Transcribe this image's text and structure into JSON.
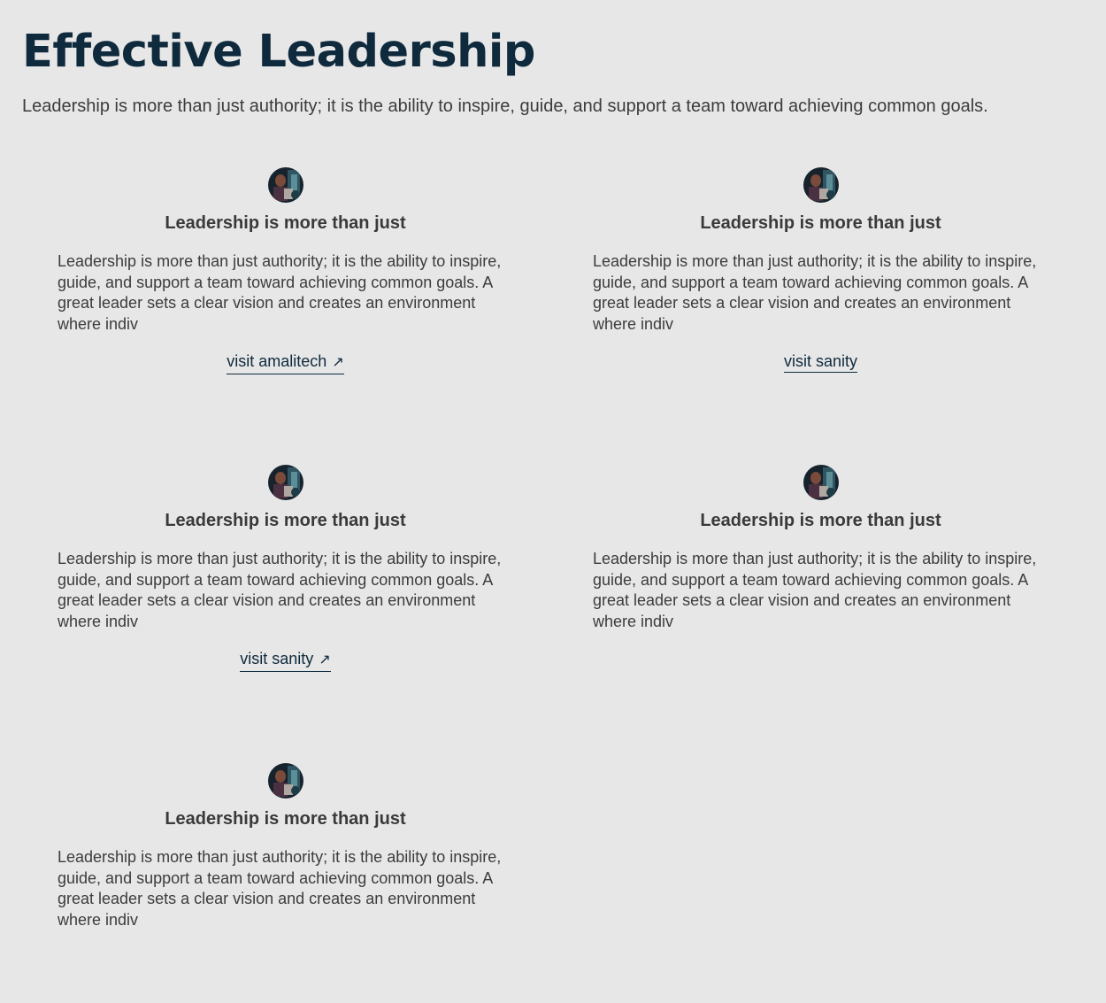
{
  "page": {
    "title": "Effective Leadership",
    "intro": "Leadership is more than just authority; it is the ability to inspire, guide, and support a team toward achieving common goals."
  },
  "cards": [
    {
      "title": "Leadership is more than just",
      "text": "Leadership is more than just authority; it is the ability to inspire, guide, and support a team toward achieving common goals. A great leader sets a clear vision and creates an environment where indiv",
      "link_label": "visit amalitech",
      "link_icon": "↗"
    },
    {
      "title": "Leadership is more than just",
      "text": "Leadership is more than just authority; it is the ability to inspire, guide, and support a team toward achieving common goals. A great leader sets a clear vision and creates an environment where indiv",
      "link_label": "visit sanity"
    },
    {
      "title": "Leadership is more than just",
      "text": "Leadership is more than just authority; it is the ability to inspire, guide, and support a team toward achieving common goals. A great leader sets a clear vision and creates an environment where indiv",
      "link_label": "visit sanity",
      "link_icon": "↗"
    },
    {
      "title": "Leadership is more than just",
      "text": "Leadership is more than just authority; it is the ability to inspire, guide, and support a team toward achieving common goals. A great leader sets a clear vision and creates an environment where indiv"
    },
    {
      "title": "Leadership is more than just",
      "text": "Leadership is more than just authority; it is the ability to inspire, guide, and support a team toward achieving common goals. A great leader sets a clear vision and creates an environment where indiv"
    }
  ],
  "colors": {
    "background": "#e7e7e7",
    "heading": "#0f2a3d",
    "body_text": "#3c3c3c"
  }
}
